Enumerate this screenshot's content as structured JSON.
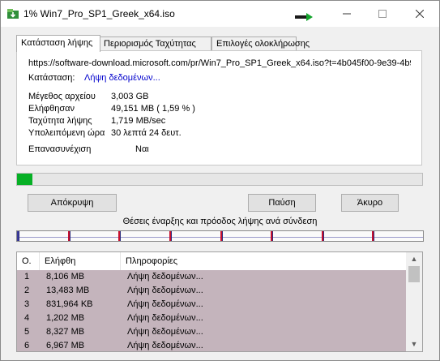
{
  "window": {
    "title": "1% Win7_Pro_SP1_Greek_x64.iso"
  },
  "tabs": [
    {
      "label": "Κατάσταση λήψης",
      "active": true
    },
    {
      "label": "Περιορισμός Ταχύτητας",
      "active": false
    },
    {
      "label": "Επιλογές ολοκλήρωσης",
      "active": false
    }
  ],
  "status": {
    "url": "https://software-download.microsoft.com/pr/Win7_Pro_SP1_Greek_x64.iso?t=4b045f00-9e39-4b9",
    "state_label": "Κατάσταση:",
    "state_value": "Λήψη δεδομένων...",
    "filesize_label": "Μέγεθος αρχείου",
    "filesize_value": "3,003  GB",
    "downloaded_label": "Ελήφθησαν",
    "downloaded_value": "49,151  MB  ( 1,59 % )",
    "rate_label": "Ταχύτητα λήψης",
    "rate_value": "1,719  MB/sec",
    "remaining_label": "Υπολειπόμενη ώρα",
    "remaining_value": "30 λεπτά 24 δευτ.",
    "resume_label": "Επανασυνέχιση",
    "resume_value": "Ναι"
  },
  "progress": {
    "percent": 1.59,
    "color": "#06b025"
  },
  "buttons": {
    "hide": "Απόκρυψη",
    "pause": "Παύση",
    "cancel": "Άκυρο"
  },
  "connections_caption": "Θέσεις έναρξης και πρόοδος λήψης ανά σύνδεση",
  "segment_starts": [
    0,
    0.125,
    0.25,
    0.375,
    0.5,
    0.625,
    0.75,
    0.875
  ],
  "table": {
    "columns": [
      "Ο.",
      "Ελήφθη",
      "Πληροφορίες"
    ],
    "rows": [
      {
        "n": "1",
        "received": "8,106  MB",
        "info": "Λήψη δεδομένων..."
      },
      {
        "n": "2",
        "received": "13,483  MB",
        "info": "Λήψη δεδομένων..."
      },
      {
        "n": "3",
        "received": "831,964  KB",
        "info": "Λήψη δεδομένων..."
      },
      {
        "n": "4",
        "received": "1,202  MB",
        "info": "Λήψη δεδομένων..."
      },
      {
        "n": "5",
        "received": "8,327  MB",
        "info": "Λήψη δεδομένων..."
      },
      {
        "n": "6",
        "received": "6,967  MB",
        "info": "Λήψη δεδομένων..."
      }
    ]
  }
}
